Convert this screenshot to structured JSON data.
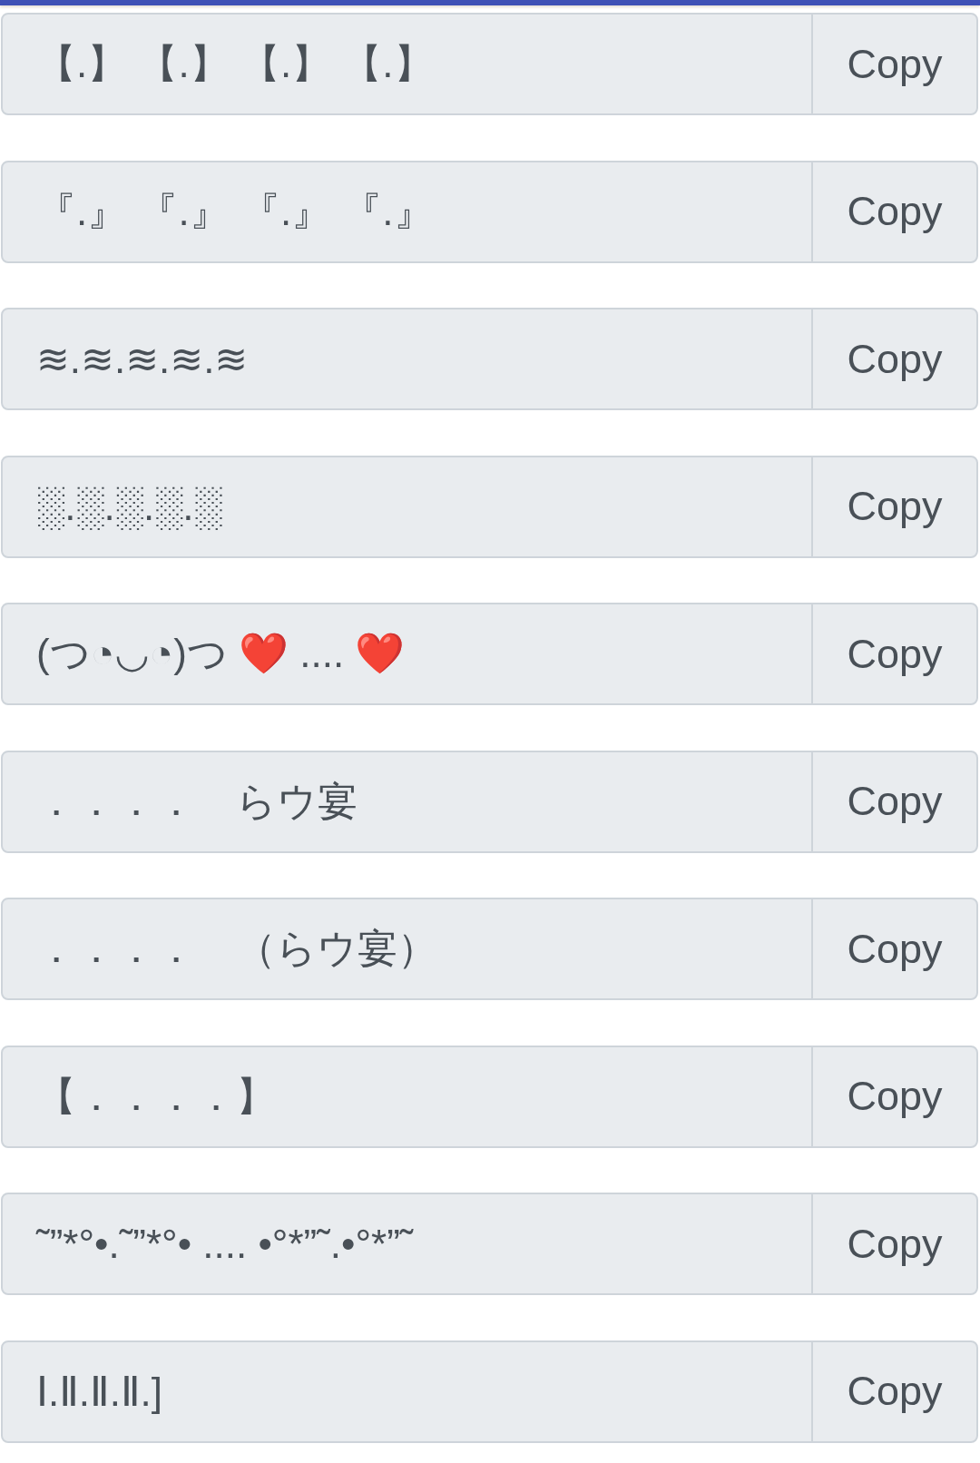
{
  "rows": [
    {
      "text": "【.】 【.】 【.】 【.】",
      "button": "Copy"
    },
    {
      "text": "『.』 『.』 『.』 『.』",
      "button": "Copy"
    },
    {
      "text": "≋.≋.≋.≋.≋",
      "button": "Copy"
    },
    {
      "text": "░.░.░.░.░",
      "button": "Copy"
    },
    {
      "text": "(つ◔◡◔)つ ❤️ .... ❤️",
      "button": "Copy"
    },
    {
      "text": "．．．．　らウ宴",
      "button": "Copy"
    },
    {
      "text": "．．．．　（らウ宴）",
      "button": "Copy"
    },
    {
      "text": "【．．．．】",
      "button": "Copy"
    },
    {
      "text": "˜”*°•.˜”*°• .... •°*”˜.•°*”˜",
      "button": "Copy"
    },
    {
      "text": "Ⅰ.Ⅱ.Ⅱ.Ⅱ.]",
      "button": "Copy"
    }
  ]
}
